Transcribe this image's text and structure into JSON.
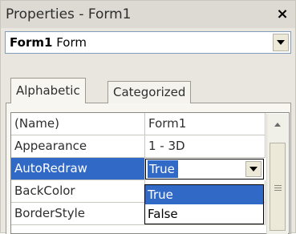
{
  "window": {
    "title": "Properties - Form1",
    "close_glyph": "✕"
  },
  "object_selector": {
    "object_name": "Form1",
    "object_type": "Form"
  },
  "tabs": [
    {
      "label": "Alphabetic",
      "active": true
    },
    {
      "label": "Categorized",
      "active": false
    }
  ],
  "properties": [
    {
      "name": "(Name)",
      "value": "Form1"
    },
    {
      "name": "Appearance",
      "value": "1 - 3D"
    },
    {
      "name": "AutoRedraw",
      "value": "True",
      "selected": true
    },
    {
      "name": "BackColor",
      "value": ""
    },
    {
      "name": "BorderStyle",
      "value": ""
    }
  ],
  "dropdown_options": [
    {
      "label": "True",
      "highlighted": true
    },
    {
      "label": "False",
      "highlighted": false
    }
  ],
  "colors": {
    "selection": "#3169c6",
    "title_bar": "#dcdad3",
    "panel": "#e8e6df"
  }
}
